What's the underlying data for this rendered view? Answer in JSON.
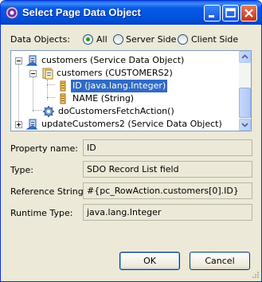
{
  "window": {
    "title": "Select Page Data Object"
  },
  "filter": {
    "label": "Data Objects:",
    "options": [
      {
        "label": "All",
        "selected": true
      },
      {
        "label": "Server Side",
        "selected": false
      },
      {
        "label": "Client Side",
        "selected": false
      }
    ]
  },
  "tree": {
    "items": [
      {
        "label": "customers (Service Data Object)",
        "expanded": true,
        "icon": "service-data-object-icon"
      },
      {
        "label": "customers (CUSTOMERS2)",
        "expanded": true,
        "icon": "record-list-icon"
      },
      {
        "label": "ID (java.lang.Integer)",
        "selected": true,
        "icon": "field-icon"
      },
      {
        "label": "NAME (String)",
        "icon": "field-icon"
      },
      {
        "label": "doCustomersFetchAction()",
        "icon": "action-gear-icon"
      },
      {
        "label": "updateCustomers2 (Service Data Object)",
        "expanded": false,
        "icon": "service-data-object-icon"
      }
    ]
  },
  "properties": {
    "property_name": {
      "label": "Property name:",
      "value": "ID"
    },
    "type": {
      "label": "Type:",
      "value": "SDO Record List field"
    },
    "reference_string": {
      "label": "Reference String:",
      "value": "#{pc_RowAction.customers[0].ID}"
    },
    "runtime_type": {
      "label": "Runtime Type:",
      "value": "java.lang.Integer"
    }
  },
  "buttons": {
    "ok": "OK",
    "cancel": "Cancel"
  },
  "colors": {
    "title_bar": "#0054e3",
    "selection": "#316ac5",
    "dialog_bg": "#ece9d8"
  }
}
